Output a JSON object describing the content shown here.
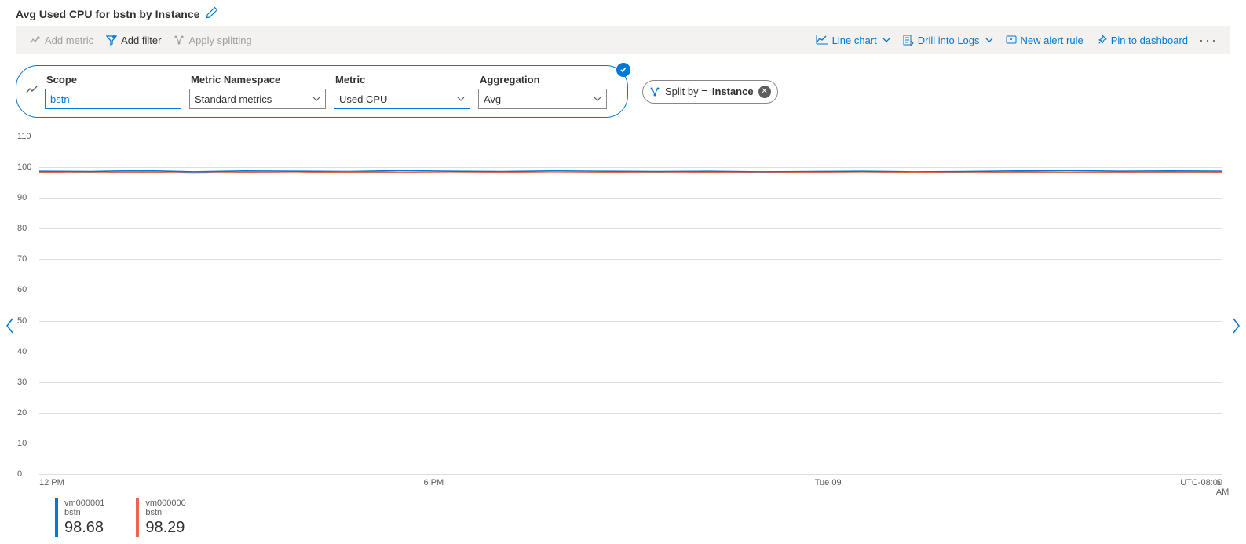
{
  "title": "Avg Used CPU for bstn by Instance",
  "toolbar": {
    "addMetric": "Add metric",
    "addFilter": "Add filter",
    "applySplitting": "Apply splitting",
    "lineChart": "Line chart",
    "drillLogs": "Drill into Logs",
    "newAlert": "New alert rule",
    "pinDash": "Pin to dashboard"
  },
  "config": {
    "scope": {
      "label": "Scope",
      "value": "bstn"
    },
    "namespace": {
      "label": "Metric Namespace",
      "value": "Standard metrics"
    },
    "metric": {
      "label": "Metric",
      "value": "Used CPU"
    },
    "aggregation": {
      "label": "Aggregation",
      "value": "Avg"
    }
  },
  "split": {
    "prefix": "Split by = ",
    "value": "Instance"
  },
  "legend": [
    {
      "name": "vm000001",
      "sub": "bstn",
      "value": "98.68",
      "color": "#0078d4"
    },
    {
      "name": "vm000000",
      "sub": "bstn",
      "value": "98.29",
      "color": "#e8684a"
    }
  ],
  "timezone": "UTC-08:00",
  "chart_data": {
    "type": "line",
    "title": "Avg Used CPU for bstn by Instance",
    "xlabel": "",
    "ylabel": "",
    "ylim": [
      0,
      110
    ],
    "y_ticks": [
      0,
      10,
      20,
      30,
      40,
      50,
      60,
      70,
      80,
      90,
      100,
      110
    ],
    "x_ticks": [
      "12 PM",
      "6 PM",
      "Tue 09",
      "6 AM"
    ],
    "x": [
      0,
      1,
      2,
      3,
      4,
      5,
      6,
      7,
      8,
      9,
      10,
      11,
      12,
      13,
      14,
      15,
      16,
      17,
      18,
      19,
      20,
      21,
      22,
      23
    ],
    "series": [
      {
        "name": "vm000001",
        "color": "#0078d4",
        "values": [
          98.7,
          98.6,
          98.9,
          98.5,
          98.8,
          98.7,
          98.6,
          98.9,
          98.7,
          98.6,
          98.8,
          98.7,
          98.6,
          98.7,
          98.5,
          98.6,
          98.7,
          98.5,
          98.6,
          98.8,
          98.9,
          98.7,
          98.8,
          98.7
        ]
      },
      {
        "name": "vm000000",
        "color": "#e8684a",
        "values": [
          98.3,
          98.2,
          98.4,
          98.1,
          98.3,
          98.2,
          98.4,
          98.3,
          98.2,
          98.3,
          98.2,
          98.3,
          98.2,
          98.3,
          98.2,
          98.3,
          98.2,
          98.3,
          98.2,
          98.4,
          98.3,
          98.3,
          98.4,
          98.3
        ]
      }
    ]
  }
}
